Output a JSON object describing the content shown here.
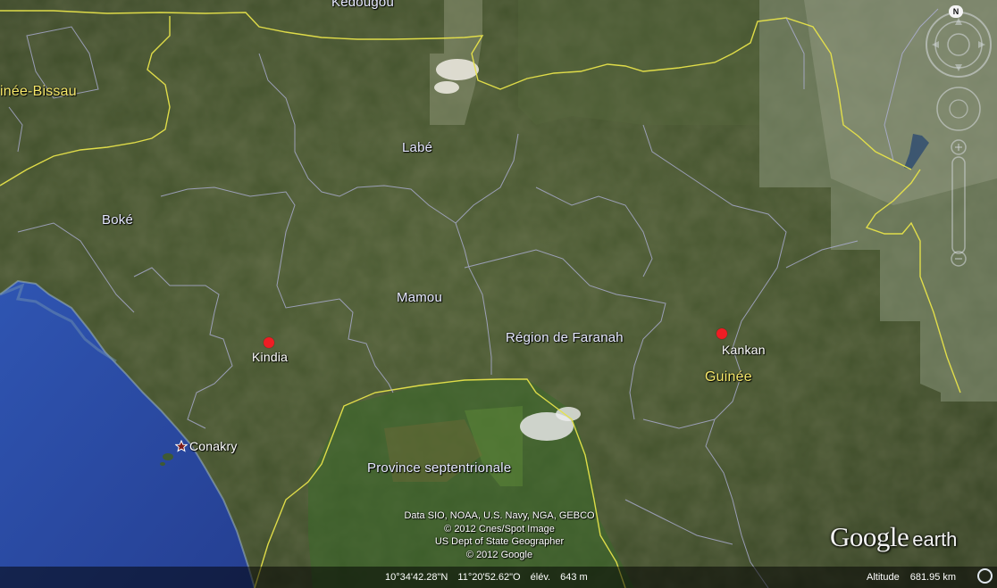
{
  "map": {
    "regions": [
      {
        "id": "labe",
        "name": "Labé"
      },
      {
        "id": "boke",
        "name": "Boké"
      },
      {
        "id": "mamou",
        "name": "Mamou"
      },
      {
        "id": "faranah",
        "name": "Région de Faranah"
      },
      {
        "id": "province-sept",
        "name": "Province septentrionale"
      },
      {
        "id": "kedougou",
        "name": "Kedougou"
      }
    ],
    "countries": [
      {
        "id": "guinea-bissau",
        "name": "inée-Bissau"
      },
      {
        "id": "guinee",
        "name": "Guinée"
      }
    ],
    "cities": [
      {
        "id": "kindia",
        "name": "Kindia"
      },
      {
        "id": "kankan",
        "name": "Kankan"
      },
      {
        "id": "conakry",
        "name": "Conakry"
      }
    ],
    "colors": {
      "ocean": "#2d4fa8",
      "land": "#46562f",
      "border_country": "#e7e34a",
      "border_region": "#b3b4e0",
      "pin": "#ee1d24"
    }
  },
  "attribution": [
    "Data SIO, NOAA, U.S. Navy, NGA, GEBCO",
    "© 2012 Cnes/Spot Image",
    "US Dept of State Geographer",
    "© 2012 Google"
  ],
  "logo": {
    "brand": "Google",
    "product": "earth"
  },
  "status": {
    "lat": "10°34'42.28\"N",
    "lon": "11°20'52.62\"O",
    "elev_label": "élév.",
    "elev_value": "643 m",
    "altitude_label": "Altitude",
    "altitude_value": "681.95 km"
  },
  "nav": {
    "north_label": "N"
  }
}
